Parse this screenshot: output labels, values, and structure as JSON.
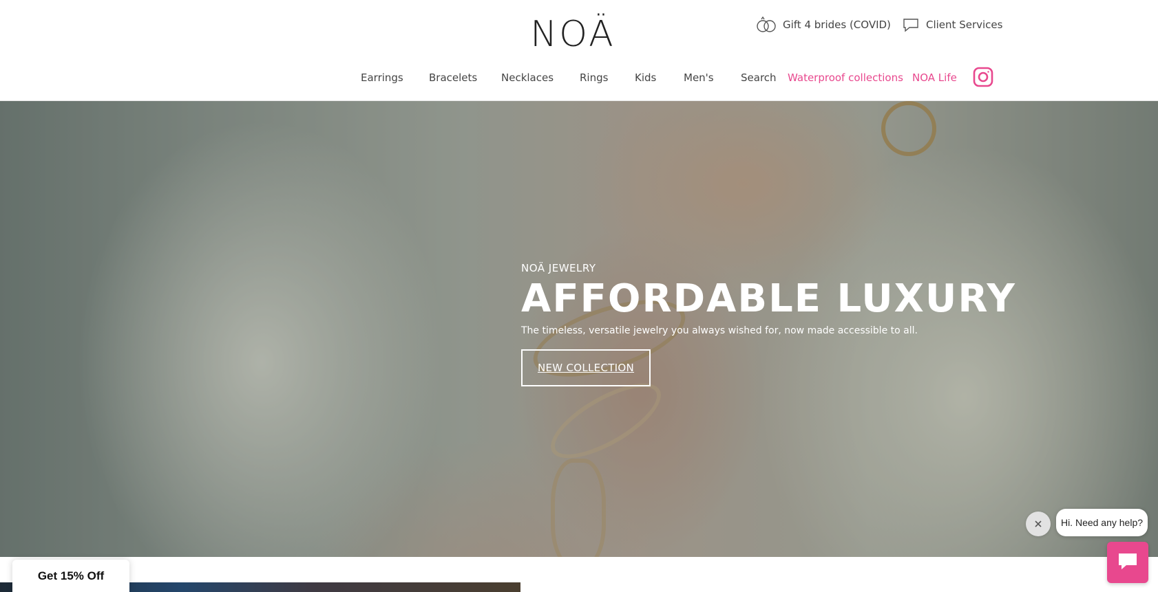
{
  "header": {
    "logo_text": "NOÄ",
    "utility": {
      "gift_label": "Gift 4 brides (COVID)",
      "gift_icon": "rings-icon",
      "client_label": "Client Services",
      "client_icon": "chat-bubble-icon"
    },
    "nav": [
      {
        "label": "Earrings",
        "color": "#444444"
      },
      {
        "label": "Bracelets",
        "color": "#444444"
      },
      {
        "label": "Necklaces",
        "color": "#444444"
      },
      {
        "label": "Rings",
        "color": "#444444"
      },
      {
        "label": "Kids",
        "color": "#444444"
      },
      {
        "label": "Men's",
        "color": "#444444"
      },
      {
        "label": "Search",
        "color": "#444444"
      },
      {
        "label": "Waterproof collections",
        "color": "#e8488e"
      },
      {
        "label": "NOA Life",
        "color": "#e8488e"
      }
    ],
    "social_icon": "instagram-icon"
  },
  "hero": {
    "eyebrow": "NOÄ JEWELRY",
    "title": "AFFORDABLE LUXURY",
    "subtitle": "The timeless, versatile jewelry you always wished for, now made accessible to all.",
    "cta_label": "NEW COLLECTION"
  },
  "popups": {
    "discount_label": "Get 15% Off",
    "chat_greeting": "Hi. Need any help?",
    "chat_close_icon": "close-icon",
    "chat_button_icon": "chat-icon"
  },
  "colors": {
    "accent": "#e8488e",
    "text": "#444444"
  }
}
